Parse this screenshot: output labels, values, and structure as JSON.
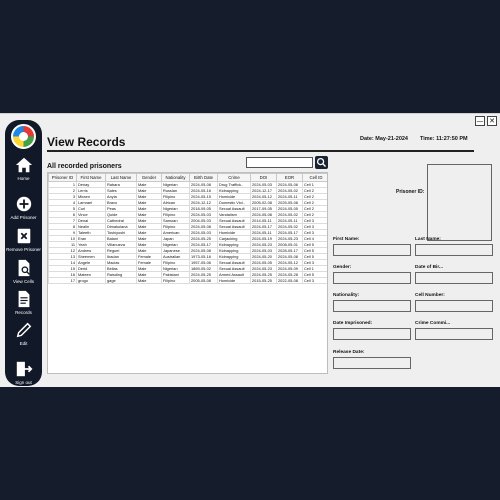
{
  "window": {
    "minimize_glyph": "—",
    "close_glyph": "✕"
  },
  "sidebar": {
    "items": [
      {
        "label": "Home",
        "icon": "home-icon"
      },
      {
        "label": "Add Prisoner",
        "icon": "plus-circle-icon"
      },
      {
        "label": "Remove Prisoner",
        "icon": "x-box-icon"
      },
      {
        "label": "View Cells",
        "icon": "document-search-icon"
      },
      {
        "label": "Records",
        "icon": "document-icon"
      },
      {
        "label": "Edit",
        "icon": "pencil-icon"
      },
      {
        "label": "Sign out",
        "icon": "sign-out-icon"
      }
    ]
  },
  "header": {
    "title": "View Records",
    "date": "Date: May-21-2024",
    "time": "Time: 11:27:50 PM"
  },
  "main": {
    "subtitle": "All recorded prisoners",
    "search": {
      "value": "",
      "placeholder": ""
    },
    "table": {
      "columns": [
        "Prisoner ID",
        "First Name",
        "Last Name",
        "Gender",
        "Nationality",
        "Birth Date",
        "Crime",
        "DOI",
        "EOR",
        "Cell ID"
      ],
      "rows": [
        [
          "1",
          "Denay",
          "Rabara",
          "Male",
          "Nigerian",
          "2024-05-08",
          "Drug Traffick..",
          "2024-05-03",
          "2024-05-06",
          "Cell 1"
        ],
        [
          "2",
          "Lerris",
          "Sales",
          "Male",
          "Russian",
          "2024-05-16",
          "Kidnapping",
          "2024-12-17",
          "2024-05-02",
          "Cell 2"
        ],
        [
          "3",
          "Miraen",
          "Anyia",
          "Male",
          "Filipino",
          "2024-05-15",
          "Homicide",
          "2024-05-12",
          "2024-05-11",
          "Cell 2"
        ],
        [
          "4",
          "Lamrael",
          "Bravo",
          "Male",
          "African",
          "2024-12-12",
          "Domestic Viol..",
          "2005-02-08",
          "2025-05-08",
          "Cell 2"
        ],
        [
          "5",
          "Curl",
          "Peas",
          "Male",
          "Nigerian",
          "2018-09-05",
          "Sexual Assault",
          "2017-09-05",
          "2024-05-05",
          "Cell 2"
        ],
        [
          "6",
          "Vince",
          "Quide",
          "Male",
          "Filipino",
          "2024-05-03",
          "Vandalism",
          "2024-05-08",
          "2024-05-02",
          "Cell 2"
        ],
        [
          "7",
          "Denai",
          "Cathedral",
          "Male",
          "Samoan",
          "2004-05-03",
          "Sexual Assault",
          "2014-05-11",
          "2024-05-11",
          "Cell 3"
        ],
        [
          "8",
          "Nealin",
          "Dimakulana",
          "Male",
          "Filipino",
          "2024-05-08",
          "Sexual Assault",
          "2024-05-17",
          "2024-05-02",
          "Cell 3"
        ],
        [
          "9",
          "Taleeth",
          "Toshiyoshi",
          "Male",
          "American",
          "2024-05-03",
          "Homicide",
          "2024-05-11",
          "2024-05-17",
          "Cell 3"
        ],
        [
          "10",
          "Eran",
          "Balani",
          "Male",
          "Japan",
          "2024-05-25",
          "Carjacking",
          "2024-05-19",
          "2024-05-23",
          "Cell 4"
        ],
        [
          "11",
          "Yeah",
          "Villanueva",
          "Male",
          "Nigerian",
          "2024-05-17",
          "Kidnapping",
          "2024-05-23",
          "2008-05-01",
          "Cell 5"
        ],
        [
          "12",
          "Andrew",
          "Reguel",
          "Male",
          "Japanese",
          "2024-05-08",
          "Kidnapping",
          "2024-05-03",
          "2028-05-17",
          "Cell 5"
        ],
        [
          "13",
          "Sheemen",
          "Ibadan",
          "Female",
          "Australian",
          "1973-05-16",
          "Kidnapping",
          "2024-05-20",
          "2024-05-08",
          "Cell 5"
        ],
        [
          "14",
          "Angele",
          "Macias",
          "Female",
          "Filipino",
          "1957-05-06",
          "Sexual Assault",
          "2024-05-05",
          "2024-05-12",
          "Cell 3"
        ],
        [
          "15",
          "Derid",
          "Bellas",
          "Male",
          "Nigerian",
          "1869-05-02",
          "Sexual Assault",
          "2024-05-23",
          "2024-05-09",
          "Cell 1"
        ],
        [
          "16",
          "Mateen",
          "Raisding",
          "Male",
          "Pakistani",
          "2024-05-25",
          "Armed Assault",
          "2024-05-25",
          "2024-05-28",
          "Cell 5"
        ],
        [
          "17",
          "grogo",
          "gage",
          "Male",
          "Filipino",
          "2005-05-08",
          "Homicide",
          "2015-05-25",
          "2022-05-08",
          "Cell 3"
        ]
      ]
    }
  },
  "details": {
    "photo_label": "Prisoner ID:",
    "fields": [
      {
        "label": "First Name:",
        "value": ""
      },
      {
        "label": "Last Name:",
        "value": ""
      },
      {
        "label": "Gender:",
        "value": ""
      },
      {
        "label": "Date of Bir...",
        "value": ""
      },
      {
        "label": "Nationality:",
        "value": ""
      },
      {
        "label": "Cell Number:",
        "value": ""
      },
      {
        "label": "Date Imprisoned:",
        "value": ""
      },
      {
        "label": "Crime Commi...",
        "value": ""
      },
      {
        "label": "Release Date:",
        "value": ""
      }
    ]
  }
}
